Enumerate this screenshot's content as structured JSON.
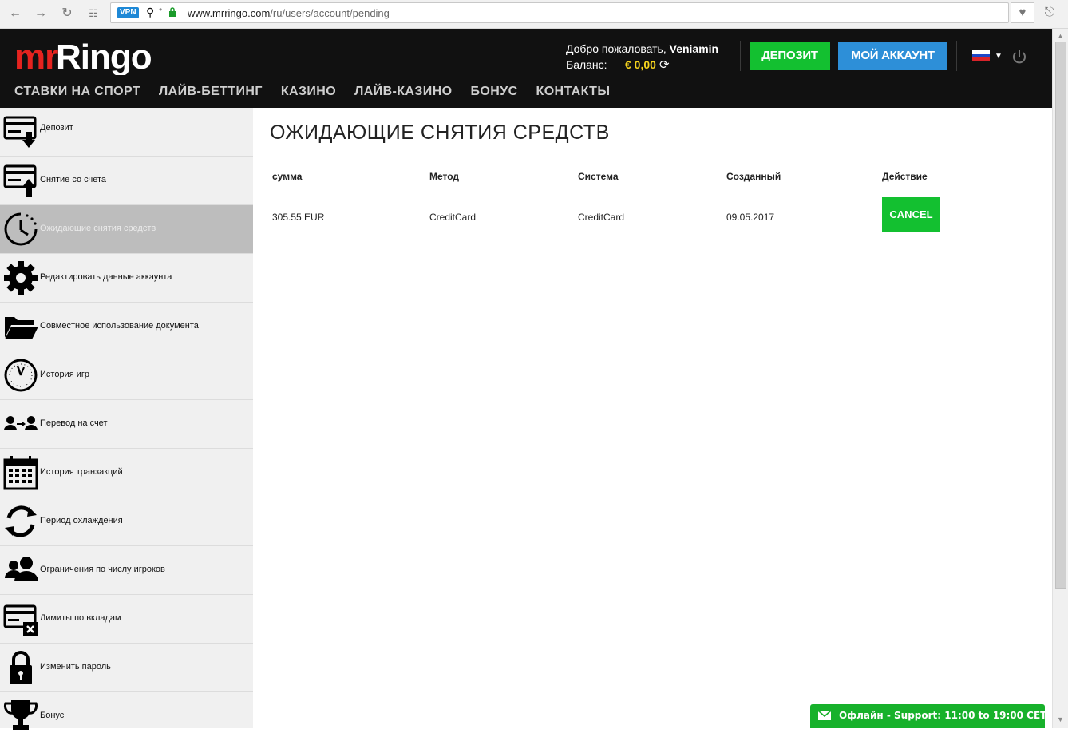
{
  "browser": {
    "vpn_badge": "VPN",
    "url_host": "www.mrringo.com",
    "url_path": "/ru/users/account/pending"
  },
  "header": {
    "logo_text": "mrRingo",
    "welcome_prefix": "Добро пожаловать,",
    "username": "Veniamin",
    "balance_label": "Баланс:",
    "balance_value": "€ 0,00",
    "deposit_label": "ДЕПОЗИТ",
    "account_label": "МОЙ АККАУНТ",
    "language": "ru",
    "nav": [
      "СТАВКИ НА СПОРТ",
      "ЛАЙВ-БЕТТИНГ",
      "КАЗИНО",
      "ЛАЙВ-КАЗИНО",
      "БОНУС",
      "КОНТАКТЫ"
    ],
    "colors": {
      "deposit": "#13c030",
      "account": "#2d8fd8",
      "balance": "#f7d51d"
    }
  },
  "sidebar": {
    "items": [
      {
        "label": "Депозит",
        "icon": "deposit-icon"
      },
      {
        "label": "Снятие со счета",
        "icon": "withdraw-icon"
      },
      {
        "label": "Ожидающие снятия средств",
        "icon": "pending-clock-icon",
        "active": true
      },
      {
        "label": "Редактировать данные аккаунта",
        "icon": "gear-icon"
      },
      {
        "label": "Совместное использование документа",
        "icon": "folder-icon"
      },
      {
        "label": "История игр",
        "icon": "clock-icon"
      },
      {
        "label": "Перевод на счет",
        "icon": "transfer-icon"
      },
      {
        "label": "История транзакций",
        "icon": "calendar-icon"
      },
      {
        "label": "Период охлаждения",
        "icon": "refresh-icon"
      },
      {
        "label": "Ограничения по числу игроков",
        "icon": "users-icon"
      },
      {
        "label": "Лимиты по вкладам",
        "icon": "card-limit-icon"
      },
      {
        "label": "Изменить пароль",
        "icon": "lock-icon"
      },
      {
        "label": "Бонус",
        "icon": "trophy-icon"
      }
    ]
  },
  "main": {
    "title": "ОЖИДАЮЩИЕ СНЯТИЯ СРЕДСТВ",
    "columns": [
      "сумма",
      "Метод",
      "Система",
      "Созданный",
      "Действие"
    ],
    "rows": [
      {
        "amount": "305.55 EUR",
        "method": "CreditCard",
        "system": "CreditCard",
        "created": "09.05.2017",
        "action": "CANCEL"
      }
    ]
  },
  "support": {
    "text": "Офлайн - Support: 11:00 to 19:00 CET"
  }
}
